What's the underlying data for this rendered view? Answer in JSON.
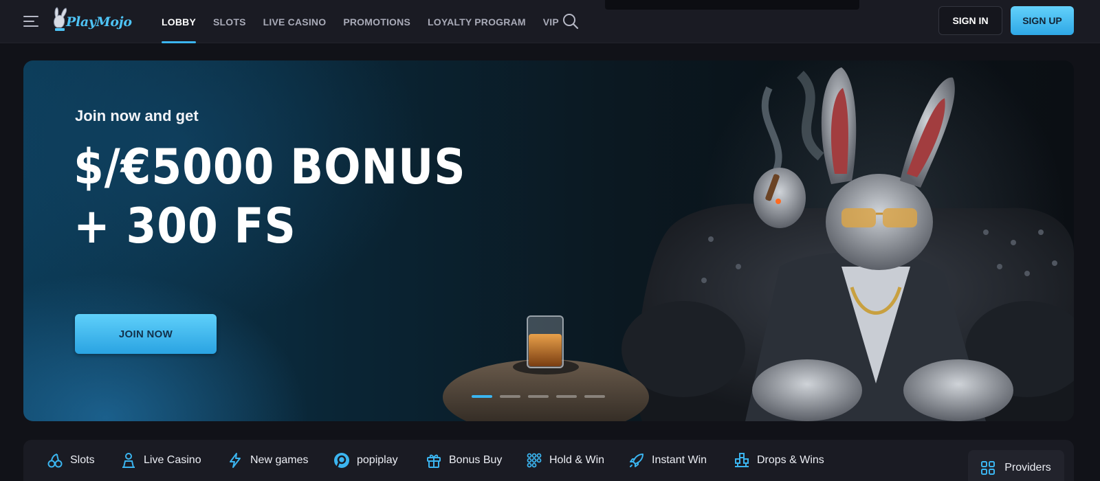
{
  "header": {
    "logo_text": "PlayMojo",
    "nav": [
      {
        "label": "LOBBY",
        "active": true
      },
      {
        "label": "SLOTS"
      },
      {
        "label": "LIVE CASINO"
      },
      {
        "label": "PROMOTIONS"
      },
      {
        "label": "LOYALTY PROGRAM"
      },
      {
        "label": "VIP"
      }
    ],
    "sign_in": "SIGN IN",
    "sign_up": "SIGN UP",
    "icons": {
      "menu": "hamburger-icon",
      "search": "search-icon"
    }
  },
  "hero": {
    "subtitle": "Join now and get",
    "title_line1": "$/€5000 BONUS",
    "title_line2": "+ 300 FS",
    "cta": "JOIN NOW",
    "slides_total": 5,
    "active_slide": 1
  },
  "categories": {
    "items": [
      {
        "label": "Slots",
        "icon": "cherries-icon"
      },
      {
        "label": "Live Casino",
        "icon": "dealer-icon"
      },
      {
        "label": "New games",
        "icon": "lightning-icon"
      },
      {
        "label": "popiplay",
        "icon": "popiplay-logo-icon"
      },
      {
        "label": "Bonus Buy",
        "icon": "gift-icon"
      },
      {
        "label": "Hold & Win",
        "icon": "grid-dots-icon"
      },
      {
        "label": "Instant Win",
        "icon": "rocket-icon"
      },
      {
        "label": "Drops & Wins",
        "icon": "blocks-icon"
      }
    ],
    "providers": "Providers"
  },
  "colors": {
    "accent": "#3bb5f0",
    "header_bg": "#1a1b23",
    "page_bg": "#111218"
  }
}
